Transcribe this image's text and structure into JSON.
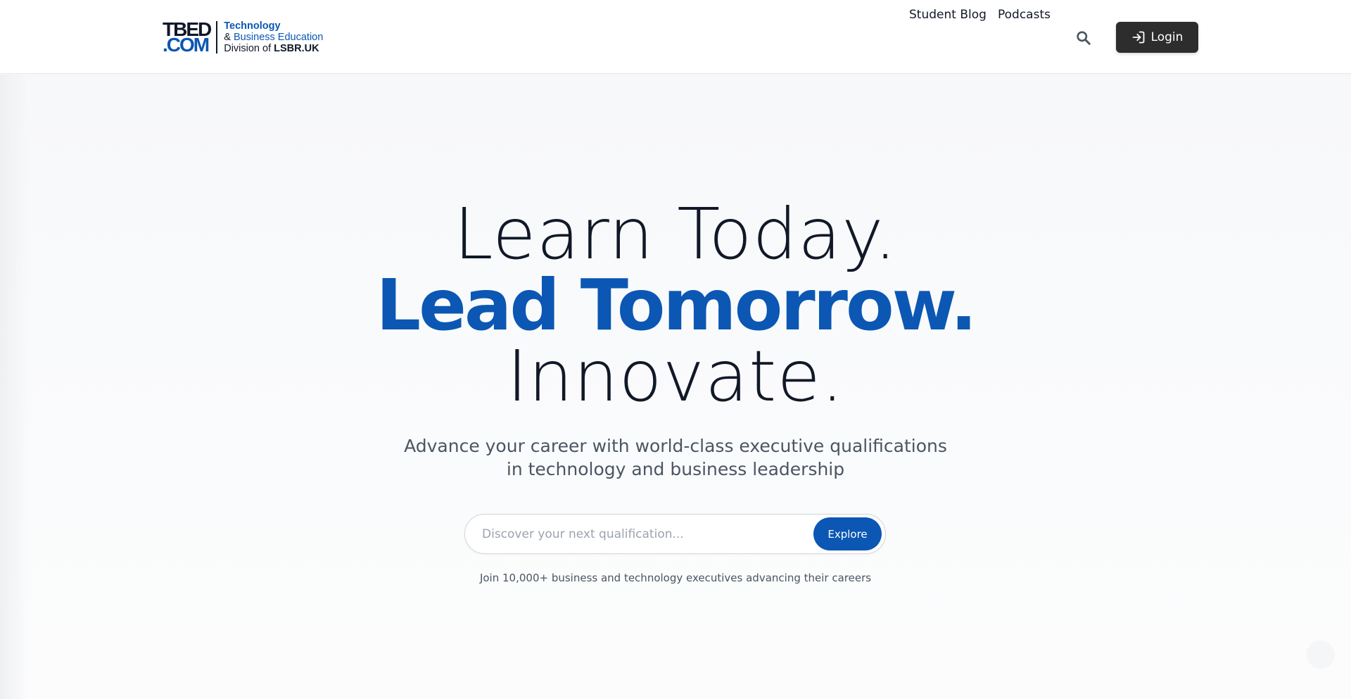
{
  "header": {
    "logo": {
      "mark_top": "TBED",
      "mark_bottom": ".COM",
      "line1": "Technology",
      "line2_amp": "& ",
      "line2": "Business Education",
      "line3_prefix": "Division of ",
      "line3_bold": "LSBR.UK"
    },
    "nav": {
      "blog": "Student Blog",
      "podcasts": "Podcasts",
      "search_icon": "search-icon",
      "login_label": "Login",
      "login_icon": "sign-in-icon"
    }
  },
  "hero": {
    "line1": "Learn Today.",
    "line2": "Lead Tomorrow.",
    "line3": "Innovate.",
    "subtitle_line1": "Advance your career with world-class executive qualifications",
    "subtitle_line2": "in technology and business leadership",
    "search": {
      "placeholder": "Discover your next qualification...",
      "value": "",
      "button": "Explore"
    },
    "social_proof": "Join 10,000+ business and technology executives advancing their careers"
  },
  "colors": {
    "brand_blue": "#0b57b3",
    "dark": "#111827",
    "login_bg": "#2d2d2d"
  }
}
